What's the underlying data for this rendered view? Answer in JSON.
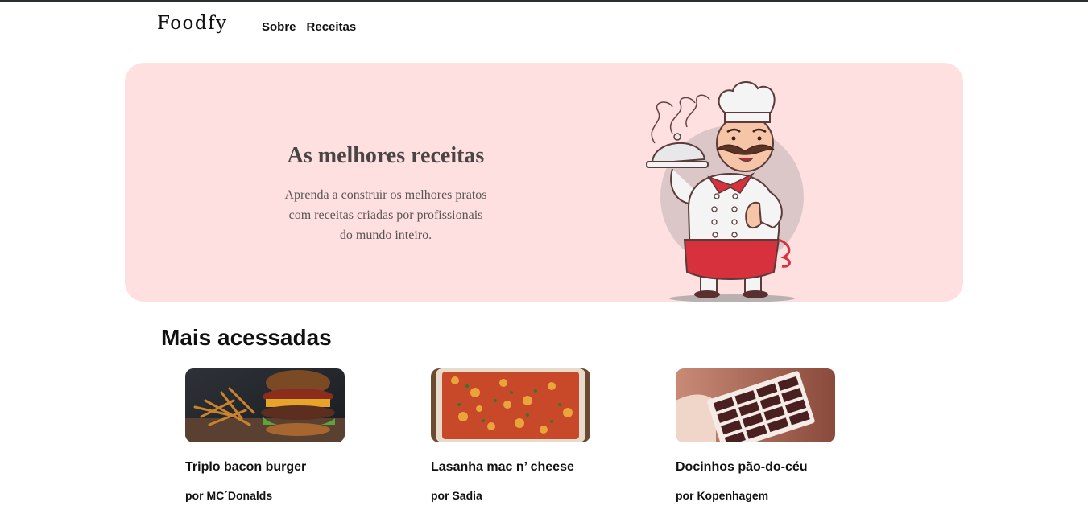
{
  "header": {
    "logo": "Foodfy",
    "nav": [
      {
        "label": "Sobre"
      },
      {
        "label": "Receitas"
      }
    ]
  },
  "hero": {
    "title": "As melhores receitas",
    "subtitle_lines": [
      "Aprenda a construir os melhores pratos",
      "com receitas criadas por profissionais",
      "do mundo inteiro."
    ],
    "illustration": "chef-icon",
    "background_color": "#fde0df"
  },
  "section": {
    "title": "Mais acessadas"
  },
  "recipes": [
    {
      "title": "Triplo bacon burger",
      "author": "por MC´Donalds",
      "image": "burger-photo"
    },
    {
      "title": "Lasanha mac n’ cheese",
      "author": "por Sadia",
      "image": "lasagna-photo"
    },
    {
      "title": "Docinhos pão-do-céu",
      "author": "por Kopenhagem",
      "image": "chocolates-photo"
    }
  ]
}
